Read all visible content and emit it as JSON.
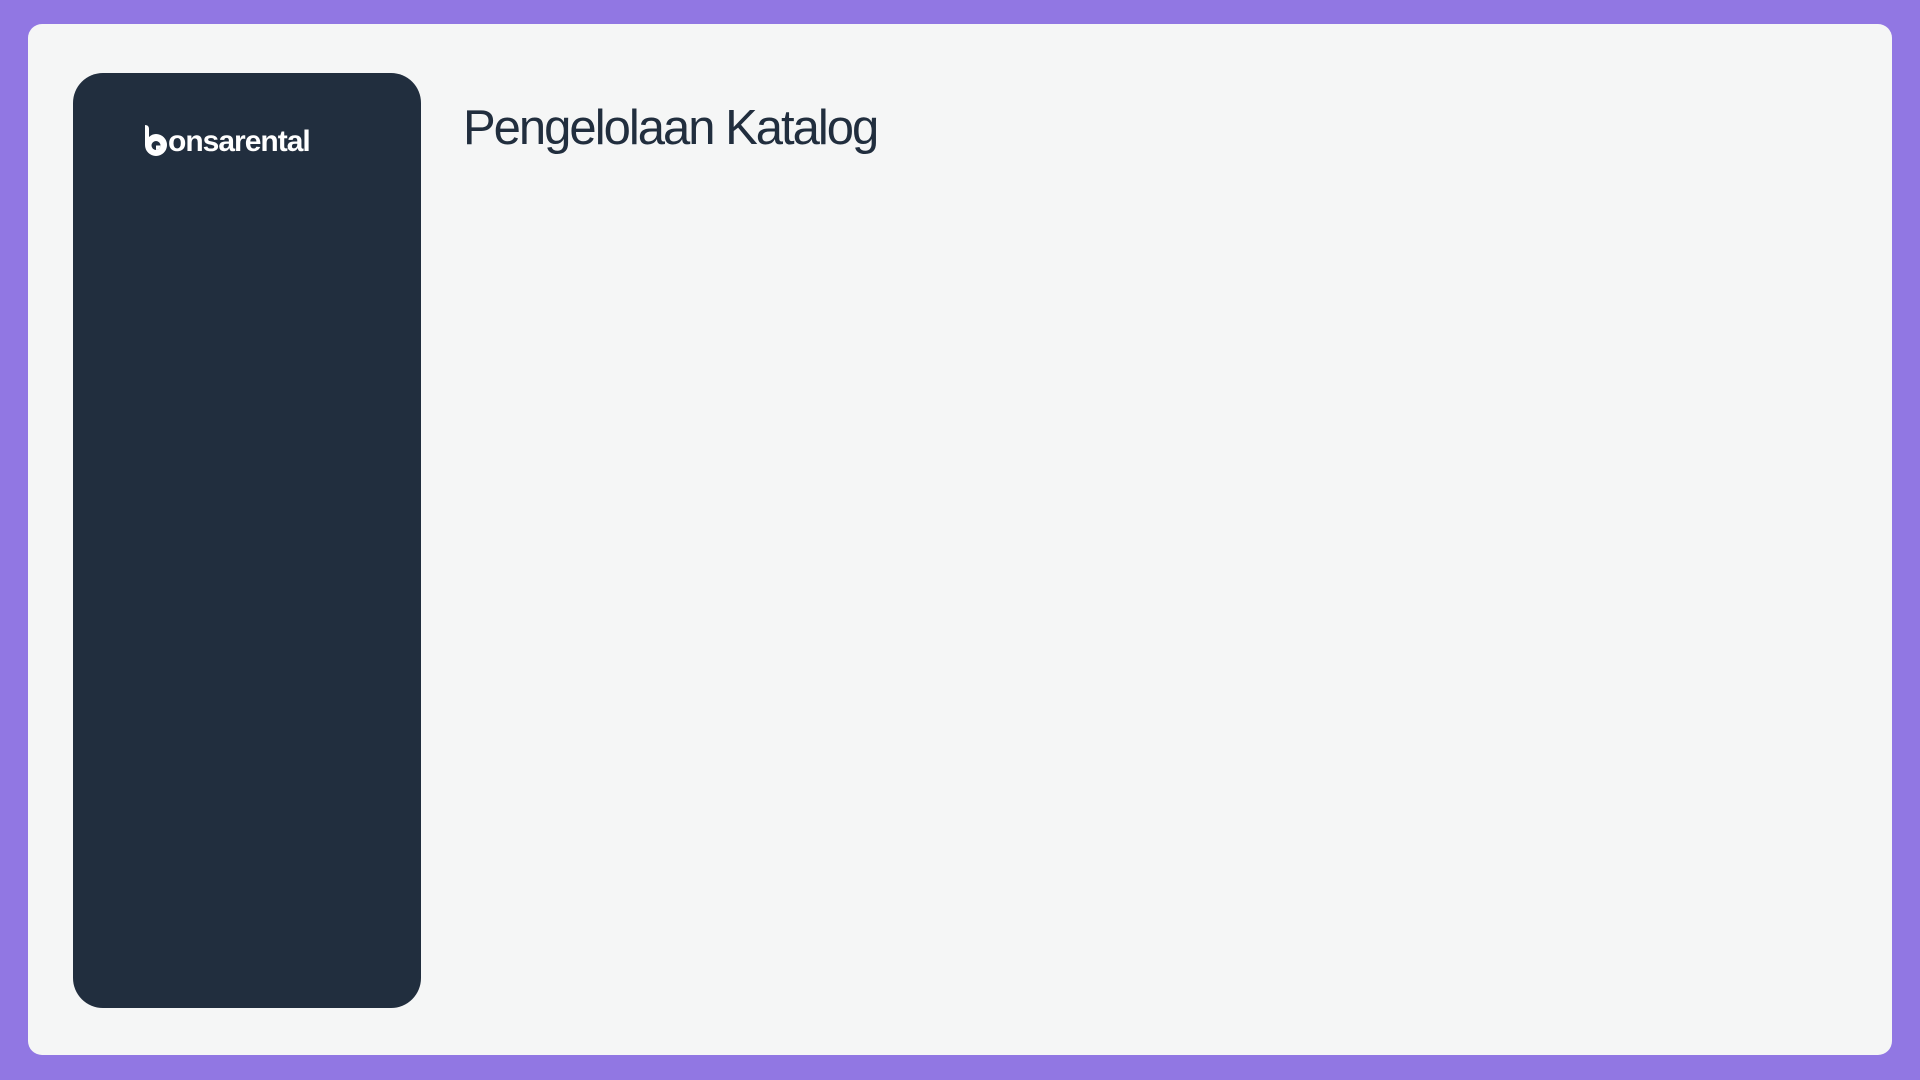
{
  "brand": {
    "logo_text": "bonsarental",
    "logo_suffix": "onsarental"
  },
  "main": {
    "title": "Pengelolaan Katalog"
  },
  "colors": {
    "frame": "#9177e3",
    "sidebar": "#212e3e",
    "background": "#f5f6f6"
  }
}
